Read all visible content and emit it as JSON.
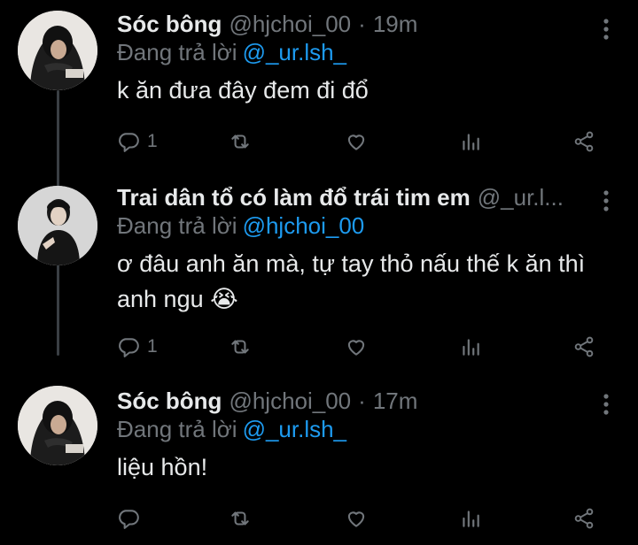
{
  "tweets": [
    {
      "name": "Sóc bông",
      "handle": "@hjchoi_00",
      "separator": "·",
      "time": "19m",
      "replying_prefix": "Đang trả lời",
      "replying_to": "@_ur.lsh_",
      "text": "k ăn đưa đây đem đi đổ",
      "reply_count": "1",
      "avatar_icon": "hooded-person-avatar"
    },
    {
      "name": "Trai dân tổ có làm đổ trái tim em",
      "handle": "@_ur.l...",
      "separator": "",
      "time": "",
      "replying_prefix": "Đang trả lời",
      "replying_to": "@hjchoi_00",
      "text": "ơ đâu anh ăn mà, tự tay thỏ nấu thế k ăn thì anh ngu 😭",
      "reply_count": "1",
      "avatar_icon": "person-in-black-avatar"
    },
    {
      "name": "Sóc bông",
      "handle": "@hjchoi_00",
      "separator": "·",
      "time": "17m",
      "replying_prefix": "Đang trả lời",
      "replying_to": "@_ur.lsh_",
      "text": "liệu hồn!",
      "reply_count": "",
      "avatar_icon": "hooded-person-avatar"
    }
  ],
  "icons": {
    "reply": "reply-icon",
    "retweet": "retweet-icon",
    "like": "heart-icon",
    "views": "analytics-icon",
    "share": "share-icon",
    "more": "more-vertical-icon"
  },
  "colors": {
    "background": "#000000",
    "text": "#e7e9ea",
    "muted": "#71767b",
    "link": "#1d9bf0",
    "thread_line": "#3a3f44"
  }
}
